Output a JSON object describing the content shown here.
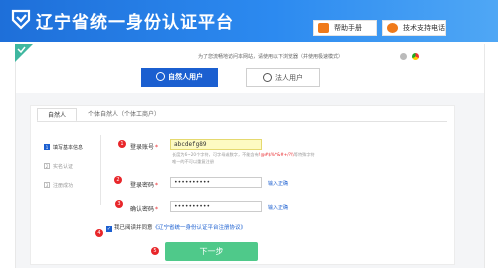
{
  "header": {
    "title": "辽宁省统一身份认证平台",
    "manual_label": "帮助手册",
    "support_label": "技术支持电话"
  },
  "notice": "为了您流畅地访问本网站，请使用以下浏览器（并使用极速模式）",
  "user_tabs": [
    {
      "label": "自然人用户",
      "active": true
    },
    {
      "label": "法人用户",
      "active": false
    }
  ],
  "type_tabs": [
    {
      "label": "自然人",
      "active": true
    },
    {
      "label": "个体自然人（个体工商户）",
      "active": false
    }
  ],
  "steps": [
    {
      "label": "填写基本信息",
      "number": "1",
      "active": true
    },
    {
      "label": "实名认证",
      "number": "2",
      "active": false
    },
    {
      "label": "注册成功",
      "number": "3",
      "active": false
    }
  ],
  "markers": [
    "1",
    "2",
    "3",
    "4",
    "5"
  ],
  "form": {
    "account_label": "登录账号",
    "account_value": "abcdefg89",
    "account_hint_line1_a": "长度为6~20个字符，可字母或数字，不能含有",
    "account_hint_line1_b": "!@#$%*&#+/?\\\\",
    "account_hint_line1_c": "等特殊字符",
    "account_hint_line2": "唯一的不可以重复注册",
    "password_label": "登录密码",
    "password_value": "••••••••••",
    "password_status": "输入正确",
    "confirm_label": "确认密码",
    "confirm_value": "••••••••••",
    "confirm_status": "输入正确",
    "required_mark": "*",
    "agree_prefix": "我已阅读并同意",
    "agree_link": "《辽宁省统一身份认证平台注册协议》",
    "next_label": "下一步"
  },
  "colors": {
    "header_blue": "#1e6fd9",
    "primary_blue": "#1b5fd0",
    "marker_red": "#e8262a",
    "next_green": "#4fc98a",
    "account_field_yellow": "#fdfac2"
  }
}
